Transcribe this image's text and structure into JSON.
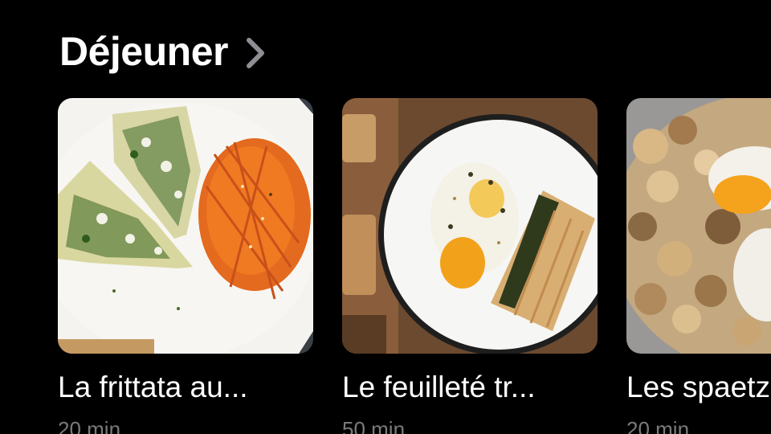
{
  "section": {
    "title": "Déjeuner",
    "chevron_icon": "chevron-right-icon"
  },
  "cards": [
    {
      "title": "La frittata au...",
      "duration": "20 min",
      "image_icon": "frittata-carrot-salad-photo"
    },
    {
      "title": "Le feuilleté tr...",
      "duration": "50 min",
      "image_icon": "puff-pastry-poached-egg-photo"
    },
    {
      "title": "Les spaetzle",
      "duration": "20 min",
      "image_icon": "spaetzle-mushroom-egg-photo"
    }
  ],
  "colors": {
    "background": "#000000",
    "text": "#ffffff",
    "meta": "#7a7a7a",
    "chevron": "#8e8e93"
  }
}
